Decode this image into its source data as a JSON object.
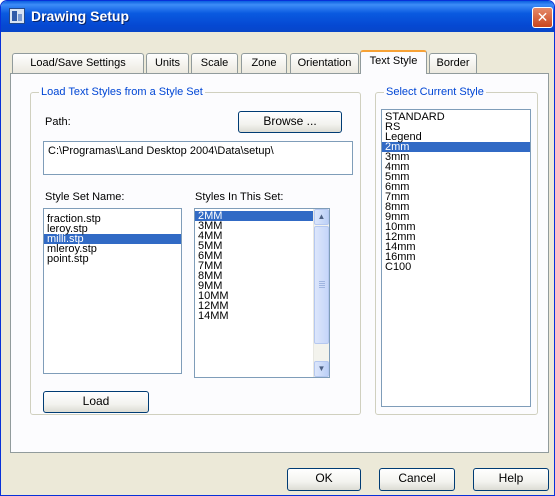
{
  "window": {
    "title": "Drawing Setup",
    "close_glyph": "✕"
  },
  "tabs": [
    {
      "label": "Load/Save Settings",
      "active": false
    },
    {
      "label": "Units",
      "active": false
    },
    {
      "label": "Scale",
      "active": false
    },
    {
      "label": "Zone",
      "active": false
    },
    {
      "label": "Orientation",
      "active": false
    },
    {
      "label": "Text Style",
      "active": true
    },
    {
      "label": "Border",
      "active": false
    }
  ],
  "load_group": {
    "legend": "Load Text Styles from a Style Set",
    "path_label": "Path:",
    "browse_label": "Browse ...",
    "path_value": "C:\\Programas\\Land Desktop 2004\\Data\\setup\\",
    "style_set_label": "Style Set Name:",
    "styles_in_set_label": "Styles In This Set:",
    "style_sets": [
      "fraction.stp",
      "leroy.stp",
      "milli.stp",
      "mleroy.stp",
      "point.stp"
    ],
    "selected_style_set": "milli.stp",
    "styles_in_set": [
      "2MM",
      "3MM",
      "4MM",
      "5MM",
      "6MM",
      "7MM",
      "8MM",
      "9MM",
      "10MM",
      "12MM",
      "14MM"
    ],
    "selected_style_in_set": "2MM",
    "load_label": "Load"
  },
  "current_group": {
    "legend": "Select Current Style",
    "styles": [
      "STANDARD",
      "RS",
      "Legend",
      "2mm",
      "3mm",
      "4mm",
      "5mm",
      "6mm",
      "7mm",
      "8mm",
      "9mm",
      "10mm",
      "12mm",
      "14mm",
      "16mm",
      "C100"
    ],
    "selected": "2mm"
  },
  "footer": {
    "ok_label": "OK",
    "cancel_label": "Cancel",
    "help_label": "Help"
  },
  "scrollbar": {
    "up_glyph": "▲",
    "down_glyph": "▼"
  },
  "colors": {
    "selection": "#316ac5",
    "group_title": "#0046d5",
    "titlebar": "#0a5ae0"
  }
}
